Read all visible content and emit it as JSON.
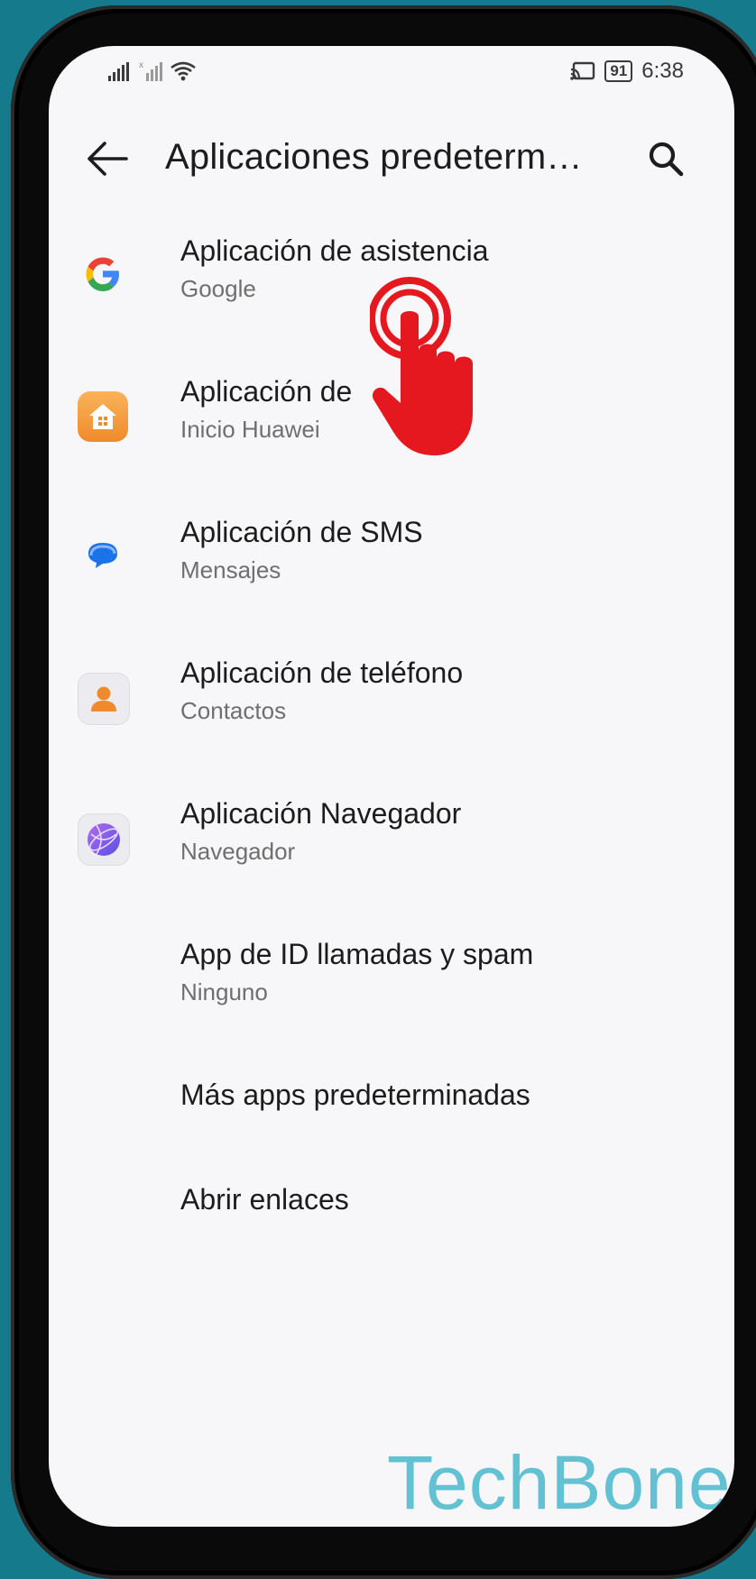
{
  "status_bar": {
    "time": "6:38",
    "battery": "91"
  },
  "header": {
    "title": "Aplicaciones predeterm…"
  },
  "items": [
    {
      "label": "Aplicación de asistencia",
      "sub": "Google",
      "icon": "google-icon"
    },
    {
      "label": "Aplicación de",
      "sub": "Inicio Huawei",
      "icon": "home-icon"
    },
    {
      "label": "Aplicación de SMS",
      "sub": "Mensajes",
      "icon": "messages-icon"
    },
    {
      "label": "Aplicación de teléfono",
      "sub": "Contactos",
      "icon": "contacts-icon"
    },
    {
      "label": "Aplicación Navegador",
      "sub": "Navegador",
      "icon": "browser-icon"
    },
    {
      "label": "App de ID llamadas y spam",
      "sub": "Ninguno"
    },
    {
      "label": "Más apps predeterminadas"
    },
    {
      "label": "Abrir enlaces"
    }
  ],
  "watermark": "TechBone",
  "colors": {
    "background": "#147a8c",
    "screen": "#f7f7f9",
    "pointer": "#e5171f",
    "watermark": "#62c2d3"
  }
}
